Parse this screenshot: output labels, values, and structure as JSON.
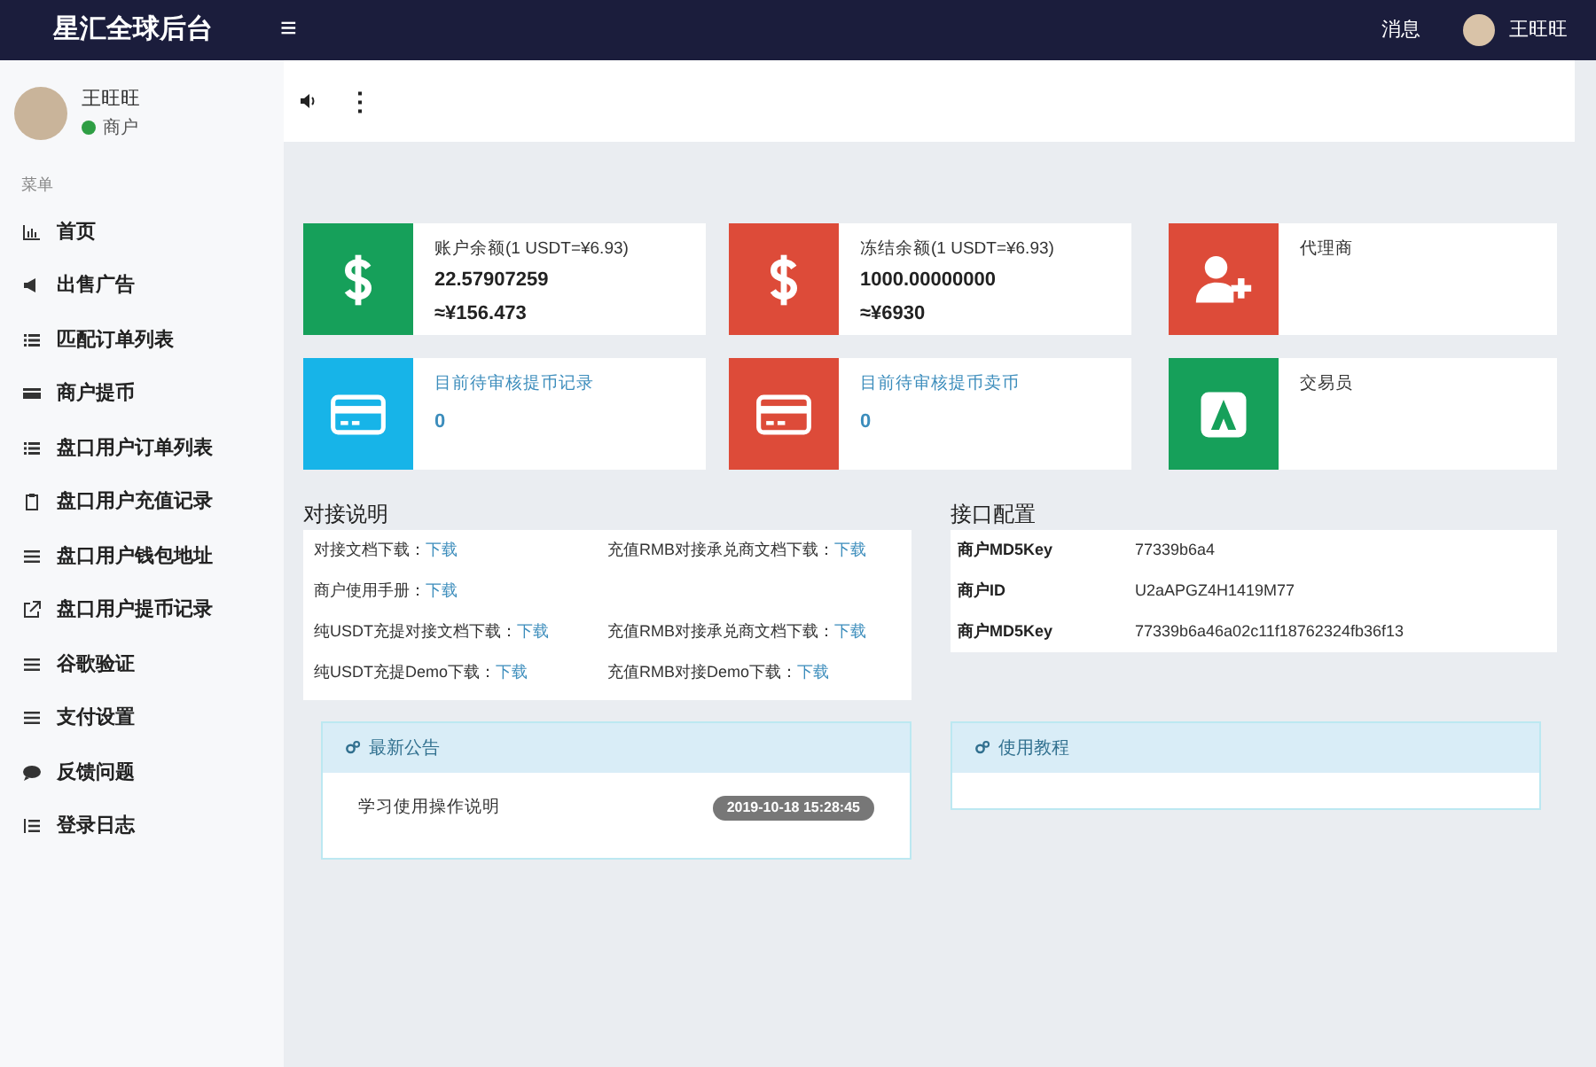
{
  "header": {
    "title": "星汇全球后台",
    "menu_icon": "≡",
    "messages": "消息",
    "user": "王旺旺"
  },
  "profile": {
    "name": "王旺旺",
    "role": "商户",
    "online": true
  },
  "toolbar": {
    "more": "⋮"
  },
  "sidebar": {
    "heading": "菜单",
    "items": [
      {
        "label": "首页",
        "kind": "chart"
      },
      {
        "label": "出售广告",
        "kind": "bullhorn"
      },
      {
        "label": "匹配订单列表",
        "kind": "list"
      },
      {
        "label": "商户提币",
        "kind": "card"
      },
      {
        "label": "盘口用户订单列表",
        "kind": "list"
      },
      {
        "label": "盘口用户充值记录",
        "kind": "clipboard"
      },
      {
        "label": "盘口用户钱包地址",
        "kind": "bars"
      },
      {
        "label": "盘口用户提币记录",
        "kind": "external"
      },
      {
        "label": "谷歌验证",
        "kind": "bars"
      },
      {
        "label": "支付设置",
        "kind": "bars"
      },
      {
        "label": "反馈问题",
        "kind": "comment"
      },
      {
        "label": "登录日志",
        "kind": "listalt"
      }
    ]
  },
  "stats": [
    {
      "kind": "dollar",
      "color": "#16a05a",
      "label": "账户余额(1 USDT=¥6.93)",
      "values": [
        "22.57907259",
        "≈¥156.473"
      ],
      "link": false
    },
    {
      "kind": "dollar",
      "color": "#dd4b39",
      "label": "冻结余额(1 USDT=¥6.93)",
      "values": [
        "1000.00000000",
        "≈¥6930"
      ],
      "link": false
    },
    {
      "kind": "userplus",
      "color": "#dd4b39",
      "label": "代理商",
      "link": false
    },
    {
      "kind": "card",
      "color": "#17b4e8",
      "label": "目前待审核提币记录",
      "values": [
        "0"
      ],
      "link": true
    },
    {
      "kind": "card",
      "color": "#dd4b39",
      "label": "目前待审核提币卖币",
      "values": [
        "0"
      ],
      "link": true
    },
    {
      "kind": "logo",
      "color": "#16a05a",
      "label": "交易员",
      "link": false
    }
  ],
  "docs": {
    "title": "对接说明",
    "rows": [
      [
        {
          "label": "对接文档下载：",
          "link": "下载"
        },
        {
          "label": "充值RMB对接承兑商文档下载：",
          "link": "下载"
        }
      ],
      [
        {
          "label": "商户使用手册：",
          "link": "下载"
        }
      ],
      [
        {
          "label": "纯USDT充提对接文档下载：",
          "link": "下载"
        },
        {
          "label": "充值RMB对接承兑商文档下载：",
          "link": "下载"
        }
      ],
      [
        {
          "label": "纯USDT充提Demo下载：",
          "link": "下载"
        },
        {
          "label": "充值RMB对接Demo下载：",
          "link": "下载"
        }
      ]
    ]
  },
  "config": {
    "title": "接口配置",
    "rows": [
      {
        "label": "商户MD5Key",
        "value": "77339b6a4"
      },
      {
        "label": "商户ID",
        "value": "U2aAPGZ4H1419M77"
      },
      {
        "label": "商户MD5Key",
        "value": "77339b6a46a02c11f18762324fb36f13"
      }
    ]
  },
  "notice": {
    "title": "最新公告",
    "items": [
      {
        "text": "学习使用操作说明",
        "time": "2019-10-18 15:28:45"
      }
    ]
  },
  "tutorial": {
    "title": "使用教程"
  }
}
